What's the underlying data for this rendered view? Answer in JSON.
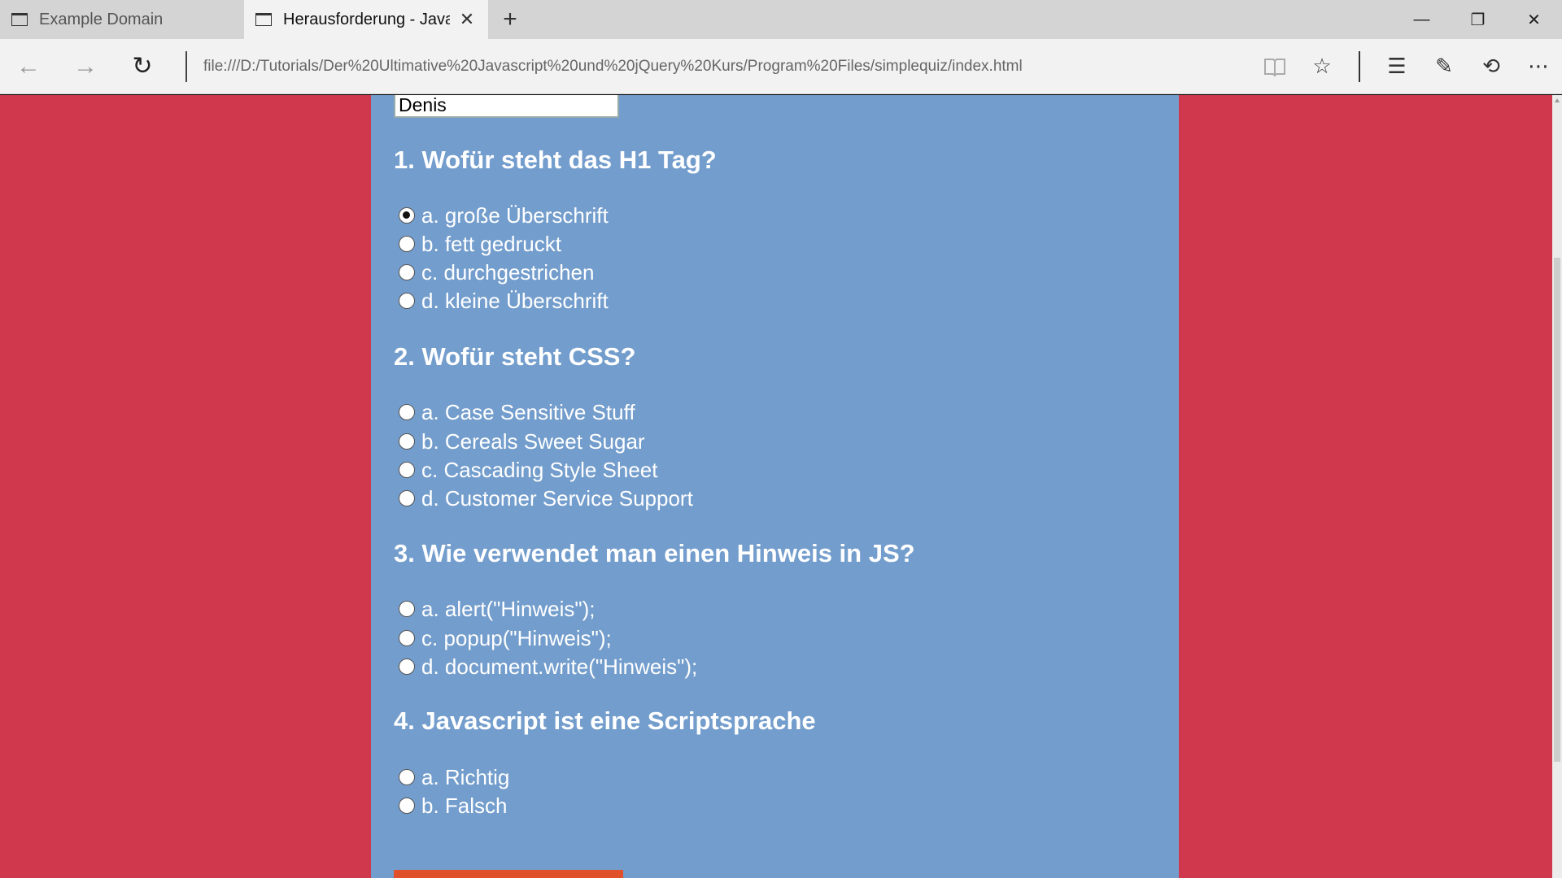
{
  "tabs": [
    {
      "title": "Example Domain",
      "active": false
    },
    {
      "title": "Herausforderung - Javas",
      "active": true
    }
  ],
  "address": {
    "url": "file:///D:/Tutorials/Der%20Ultimative%20Javascript%20und%20jQuery%20Kurs/Program%20Files/simplequiz/index.html"
  },
  "icons": {
    "back": "←",
    "forward": "→",
    "refresh": "↻",
    "close_tab": "✕",
    "new_tab": "+",
    "minimize": "—",
    "restore": "❐",
    "close_window": "✕",
    "reading_view": "📖",
    "favorite": "☆",
    "hub": "☰",
    "notes": "✎",
    "share": "⟲",
    "more": "⋯"
  },
  "quiz": {
    "name_value": "Denis",
    "questions": [
      {
        "title": "1. Wofür steht das H1 Tag?",
        "options": [
          "a. große Überschrift",
          "b. fett gedruckt",
          "c. durchgestrichen",
          "d. kleine Überschrift"
        ],
        "selected": 0
      },
      {
        "title": "2. Wofür steht CSS?",
        "options": [
          "a. Case Sensitive Stuff",
          "b. Cereals Sweet Sugar",
          "c. Cascading Style Sheet",
          "d. Customer Service Support"
        ],
        "selected": -1
      },
      {
        "title": "3. Wie verwendet man einen Hinweis in JS?",
        "options": [
          "a. alert(\"Hinweis\");",
          "c. popup(\"Hinweis\");",
          "d. document.write(\"Hinweis\");"
        ],
        "selected": -1
      },
      {
        "title": "4. Javascript ist eine Scriptsprache",
        "options": [
          "a. Richtig",
          "b. Falsch"
        ],
        "selected": -1
      }
    ]
  },
  "colors": {
    "page_bg": "#d0394d",
    "quiz_bg": "#739dcc",
    "submit": "#e0502b"
  }
}
